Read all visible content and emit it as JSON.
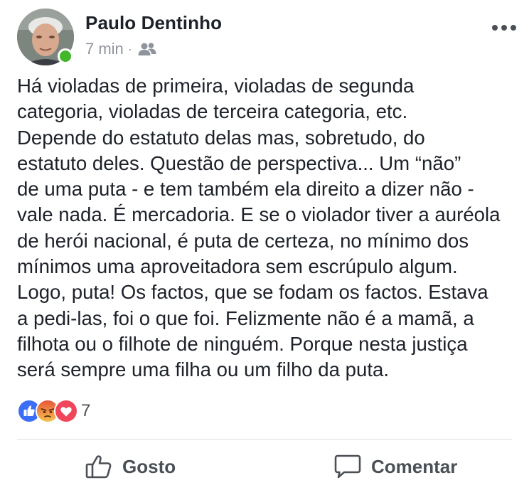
{
  "post": {
    "author": "Paulo Dentinho",
    "time": "7 min",
    "separator": "·",
    "audience_icon": "friends-icon",
    "text": "Há violadas de primeira, violadas de segunda\ncategoria, violadas de terceira categoria, etc.\nDepende do estatuto delas mas, sobretudo, do\nestatuto deles. Questão de perspectiva... Um “não”\nde uma puta - e tem também ela direito a dizer não -\nvale nada. É mercadoria. E se o violador tiver a auréola\nde herói nacional, é puta de certeza, no mínimo dos\nmínimos uma aproveitadora sem escrúpulo algum.\nLogo, puta! Os factos, que se fodam os factos. Estava\na pedi-las, foi o que foi. Felizmente não é a mamã, a\nfilhota ou o filhote de ninguém. Porque nesta justiça\nserá sempre uma filha ou um filho da puta."
  },
  "reactions": {
    "types": [
      "like",
      "angry",
      "love"
    ],
    "count": "7"
  },
  "actions": {
    "like_label": "Gosto",
    "comment_label": "Comentar"
  },
  "colors": {
    "like": "#3b6ef6",
    "angry": "#f0a93a",
    "love": "#f0465b",
    "online": "#42b72a",
    "secondary_text": "#90949c",
    "action_text": "#4b4f56"
  }
}
